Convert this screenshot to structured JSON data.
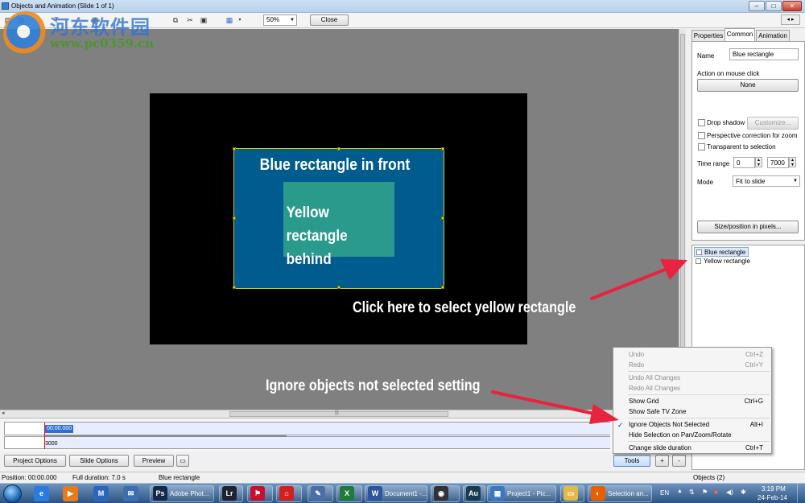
{
  "window": {
    "title": "Objects and Animation (Slide 1 of 1)",
    "minimize": "–",
    "maximize": "□",
    "close": "✕"
  },
  "toolbar": {
    "zoom_value": "50%",
    "close_label": "Close",
    "nav_arrows": "◂ ▸"
  },
  "watermark": {
    "brand": "河东软件园",
    "url": "www.pc0359.cn"
  },
  "slide": {
    "blue_rect_label": "Blue rectangle in front",
    "yellow_rect_line1": "Yellow rectangle",
    "yellow_rect_line2": "behind"
  },
  "annotations": {
    "select_yellow": "Click here to select yellow rectangle",
    "ignore_objects": "Ignore objects not selected setting"
  },
  "colors": {
    "blue_rect": "#005b8f",
    "yellow_rect": "#2a9a8c",
    "arrow": "#e8233f",
    "slide_bg": "#000000"
  },
  "right_panel": {
    "tabs": [
      "Properties",
      "Common",
      "Animation"
    ],
    "active_tab": "Common",
    "name_label": "Name",
    "name_value": "Blue rectangle",
    "action_label": "Action on mouse click",
    "action_value": "None",
    "drop_shadow_label": "Drop shadow",
    "customize_label": "Customize...",
    "perspective_label": "Perspective correction for zoom",
    "transparent_label": "Transparent to selection",
    "time_range_label": "Time range",
    "time_from": "0",
    "time_to": "7000",
    "mode_label": "Mode",
    "mode_value": "Fit to slide",
    "size_position_label": "Size/position in pixels..."
  },
  "object_list": {
    "items": [
      "Blue rectangle",
      "Yellow rectangle"
    ],
    "selected": "Blue rectangle"
  },
  "timeline": {
    "current_time": "00:00.000",
    "marker": "3000"
  },
  "bottom_buttons": {
    "project_options": "Project Options",
    "slide_options": "Slide Options",
    "preview": "Preview",
    "tools": "Tools",
    "plus": "+",
    "minus": "-"
  },
  "context_menu": {
    "items": [
      {
        "label": "Undo",
        "shortcut": "Ctrl+Z",
        "disabled": true
      },
      {
        "label": "Redo",
        "shortcut": "Ctrl+Y",
        "disabled": true
      },
      {
        "label": "Undo All Changes",
        "shortcut": "",
        "disabled": true
      },
      {
        "label": "Redo All Changes",
        "shortcut": "",
        "disabled": true
      },
      {
        "label": "Show Grid",
        "shortcut": "Ctrl+G",
        "disabled": false
      },
      {
        "label": "Show Safe TV Zone",
        "shortcut": "",
        "disabled": false
      },
      {
        "label": "Ignore Objects Not Selected",
        "shortcut": "Alt+I",
        "disabled": false,
        "checked": true
      },
      {
        "label": "Hide Selection on Pan/Zoom/Rotate",
        "shortcut": "",
        "disabled": false
      },
      {
        "label": "Change slide duration",
        "shortcut": "Ctrl+T",
        "disabled": false
      }
    ]
  },
  "status_bar": {
    "position": "Position: 00:00.000",
    "full_duration": "Full duration: 7.0 s",
    "selected_object": "Blue rectangle",
    "objects_count": "Objects (2)"
  },
  "taskbar": {
    "apps": [
      {
        "icon": "internet-explorer-icon",
        "glyph": "e",
        "color": "#2a7be0"
      },
      {
        "icon": "media-player-icon",
        "glyph": "▶",
        "color": "#e87a1b"
      },
      {
        "icon": "maxthon-icon",
        "glyph": "M",
        "color": "#2c66b8"
      },
      {
        "icon": "thunderbird-icon",
        "glyph": "✉",
        "color": "#3b6fb0"
      }
    ],
    "windows": [
      {
        "icon": "photoshop-icon",
        "glyph": "Ps",
        "color": "#12294a",
        "label": "Adobe Phot..."
      },
      {
        "icon": "lightroom-icon",
        "glyph": "Lr",
        "color": "#1c2430",
        "label": ""
      },
      {
        "icon": "acrobat-icon",
        "glyph": "⚑",
        "color": "#c8102e",
        "label": ""
      },
      {
        "icon": "pdf-icon",
        "glyph": "⌂",
        "color": "#d12020",
        "label": ""
      },
      {
        "icon": "feather-icon",
        "glyph": "✎",
        "color": "#4a6fa5",
        "label": ""
      },
      {
        "icon": "excel-icon",
        "glyph": "X",
        "color": "#1f7a3c",
        "label": ""
      },
      {
        "icon": "word-document-icon",
        "glyph": "W",
        "color": "#2b579a",
        "label": "Document1 -..."
      },
      {
        "icon": "soccer-ball-icon",
        "glyph": "◉",
        "color": "#333333",
        "label": ""
      },
      {
        "icon": "audition-icon",
        "glyph": "Au",
        "color": "#1a3b4f",
        "label": ""
      },
      {
        "icon": "picturestoexe-icon",
        "glyph": "▦",
        "color": "#3b78c2",
        "label": "Project1 - Pic..."
      },
      {
        "icon": "folder-icon",
        "glyph": "▭",
        "color": "#e5b84a",
        "label": ""
      },
      {
        "icon": "firefox-icon",
        "glyph": "◐",
        "color": "#e66000",
        "label": "Selection an..."
      }
    ],
    "language": "EN",
    "time": "3:19 PM",
    "date": "24-Feb-14"
  }
}
